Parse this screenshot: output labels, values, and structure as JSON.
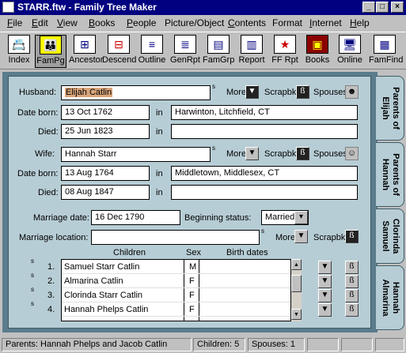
{
  "window": {
    "title": "STARR.ftw - Family Tree Maker",
    "controls": [
      "_",
      "□",
      "×"
    ]
  },
  "menu": [
    {
      "u": "F",
      "rest": "ile"
    },
    {
      "u": "E",
      "rest": "dit"
    },
    {
      "u": "V",
      "rest": "iew"
    },
    {
      "u": "B",
      "rest": "ooks"
    },
    {
      "u": "P",
      "rest": "eople"
    },
    {
      "u": "",
      "rest": "Picture/Object"
    },
    {
      "u": "C",
      "rest": "ontents"
    },
    {
      "u": "",
      "rest": "Format"
    },
    {
      "u": "I",
      "rest": "nternet"
    },
    {
      "u": "H",
      "rest": "elp"
    }
  ],
  "toolbar": [
    {
      "label": "Index",
      "glyph": "📇",
      "active": false
    },
    {
      "label": "FamPg",
      "glyph": "👪",
      "active": true
    },
    {
      "label": "Ancestor",
      "glyph": "⊞",
      "active": false
    },
    {
      "label": "Descend",
      "glyph": "⊟",
      "active": false
    },
    {
      "label": "Outline",
      "glyph": "≡",
      "active": false
    },
    {
      "label": "GenRpt",
      "glyph": "≣",
      "active": false
    },
    {
      "label": "FamGrp",
      "glyph": "▤",
      "active": false
    },
    {
      "label": "Report",
      "glyph": "▥",
      "active": false
    },
    {
      "label": "FF Rpt",
      "glyph": "★",
      "active": false
    },
    {
      "label": "Books",
      "glyph": "▣",
      "active": false
    },
    {
      "label": "Online",
      "glyph": "🖥",
      "active": false
    },
    {
      "label": "FamFind",
      "glyph": "▦",
      "active": false
    }
  ],
  "husband": {
    "label": "Husband:",
    "name": "Elijah Catlin",
    "born_label": "Date born:",
    "born": "13 Oct 1762",
    "born_place": "Harwinton, Litchfield, CT",
    "died_label": "Died:",
    "died": "25 Jun 1823",
    "died_place": ""
  },
  "wife": {
    "label": "Wife:",
    "name": "Hannah Starr",
    "born_label": "Date born:",
    "born": "13 Aug 1764",
    "born_place": "Middletown, Middlesex, CT",
    "died_label": "Died:",
    "died": "08 Aug 1847",
    "died_place": ""
  },
  "common": {
    "in": "in",
    "s_mark": "s",
    "more": "More",
    "scrapbk": "Scrapbk",
    "spouses": "Spouses"
  },
  "marriage": {
    "date_label": "Marriage date:",
    "date": "16 Dec 1790",
    "status_label": "Beginning status:",
    "status": "Married",
    "location_label": "Marriage location:",
    "location": ""
  },
  "children": {
    "headers": {
      "children": "Children",
      "sex": "Sex",
      "birth": "Birth dates"
    },
    "rows": [
      {
        "num": "1.",
        "name": "Samuel Starr Catlin",
        "sex": "M"
      },
      {
        "num": "2.",
        "name": "Almarina Catlin",
        "sex": "F"
      },
      {
        "num": "3.",
        "name": "Clorinda Starr Catlin",
        "sex": "F"
      },
      {
        "num": "4.",
        "name": "Hannah Phelps Catlin",
        "sex": "F"
      }
    ]
  },
  "tabs": [
    {
      "line1": "Parents of",
      "line2": "Elijah"
    },
    {
      "line1": "Parents of",
      "line2": "Hannah"
    },
    {
      "line1": "Clorinda",
      "line2": "Samuel"
    },
    {
      "line1": "Hannah",
      "line2": "Almarina"
    }
  ],
  "status": {
    "parents": "Parents: Hannah Phelps and Jacob Catlin",
    "children": "Children: 5",
    "spouses": "Spouses: 1"
  }
}
